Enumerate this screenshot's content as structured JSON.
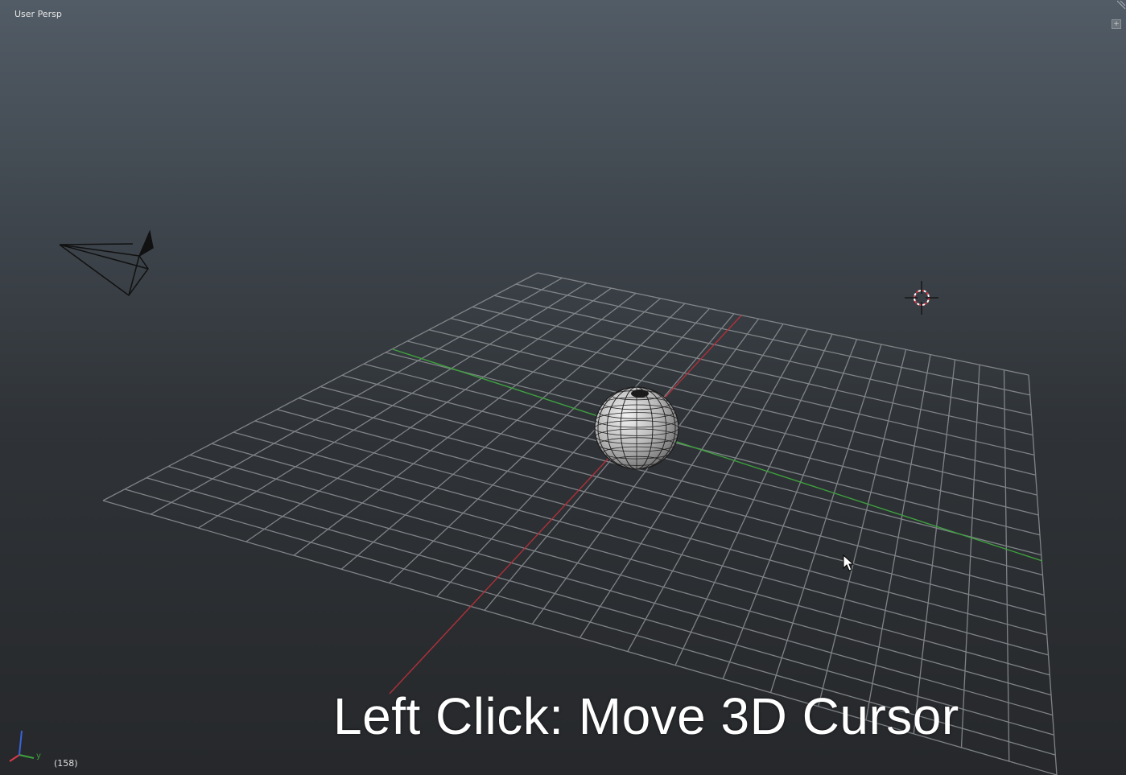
{
  "viewport": {
    "view_label": "User Persp",
    "frame_counter": "(158)",
    "caption": "Left Click: Move 3D Cursor",
    "axis_labels": {
      "y": "y"
    },
    "icons": {
      "corner_widget": "plus-icon",
      "camera": "camera-wireframe-icon",
      "cursor_3d": "3d-cursor-icon",
      "mouse_pointer": "mouse-pointer-icon",
      "axis_gizmo": "axis-gizmo-icon"
    },
    "colors": {
      "grid": "#8e9296",
      "x_axis": "#b0303a",
      "y_axis": "#3fa13f",
      "sphere": "#c9c9c9",
      "text": "#ffffff"
    }
  }
}
